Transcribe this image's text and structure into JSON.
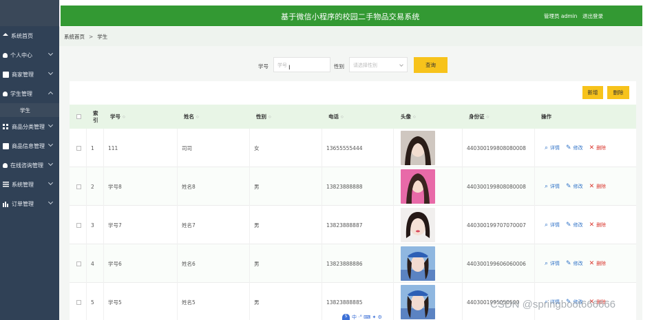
{
  "header": {
    "title": "基于微信小程序的校园二手物品交易系统",
    "user": "管理员 admin",
    "logout": "退出登录"
  },
  "sidebar": {
    "items": [
      {
        "label": "系统首页",
        "icon": "home-icon"
      },
      {
        "label": "个人中心",
        "icon": "user-icon"
      },
      {
        "label": "商家管理",
        "icon": "box-icon"
      },
      {
        "label": "学生管理",
        "icon": "user-icon",
        "expanded": true
      },
      {
        "label": "商品分类管理",
        "icon": "grid-icon"
      },
      {
        "label": "商品信息管理",
        "icon": "box-icon"
      },
      {
        "label": "在线咨询管理",
        "icon": "user-icon"
      },
      {
        "label": "系统管理",
        "icon": "lines-icon"
      },
      {
        "label": "订单管理",
        "icon": "chart-icon"
      }
    ],
    "sub_item": "学生"
  },
  "breadcrumb": {
    "home": "系统首页",
    "sep": ">",
    "current": "学生"
  },
  "search": {
    "xuehao_label": "学号",
    "xuehao_placeholder": "学号",
    "sex_label": "性别",
    "sex_placeholder": "请选择性别",
    "query_button": "查询"
  },
  "toolbar": {
    "add": "新增",
    "delete": "删除"
  },
  "table": {
    "headers": {
      "index": "索引",
      "xuehao": "学号",
      "name": "姓名",
      "sex": "性别",
      "phone": "电话",
      "avatar": "头像",
      "idcard": "身份证",
      "ops": "操作"
    },
    "sort_glyph": "◇",
    "rows": [
      {
        "index": "1",
        "xuehao": "111",
        "name": "司司",
        "sex": "女",
        "phone": "13655555444",
        "idcard": "440300199808080008"
      },
      {
        "index": "2",
        "xuehao": "学号8",
        "name": "姓名8",
        "sex": "男",
        "phone": "13823888888",
        "idcard": "440300199808080008"
      },
      {
        "index": "3",
        "xuehao": "学号7",
        "name": "姓名7",
        "sex": "男",
        "phone": "13823888887",
        "idcard": "440300199707070007"
      },
      {
        "index": "4",
        "xuehao": "学号6",
        "name": "姓名6",
        "sex": "男",
        "phone": "13823888886",
        "idcard": "440300199606060006"
      },
      {
        "index": "5",
        "xuehao": "学号5",
        "name": "姓名5",
        "sex": "男",
        "phone": "13823888885",
        "idcard": "4403001995050500"
      }
    ],
    "actions": {
      "detail": "详情",
      "edit": "修改",
      "delete": "删除"
    }
  },
  "watermark": "CSDN @springboot666666",
  "colors": {
    "header": "#339933",
    "sidebar": "#304156",
    "accent_button": "#f7c31b",
    "table_header": "#e8f5e6"
  }
}
